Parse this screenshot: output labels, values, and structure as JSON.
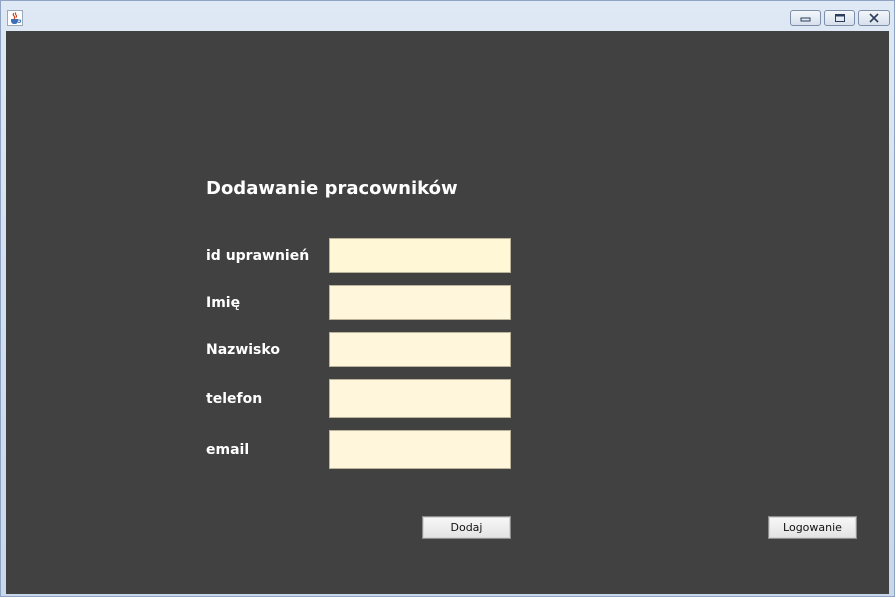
{
  "form": {
    "title": "Dodawanie pracowników",
    "fields": [
      {
        "label": "id uprawnień",
        "value": ""
      },
      {
        "label": "Imię",
        "value": ""
      },
      {
        "label": "Nazwisko",
        "value": ""
      },
      {
        "label": "telefon",
        "value": ""
      },
      {
        "label": "email",
        "value": ""
      }
    ],
    "add_button": "Dodaj"
  },
  "login_button": "Logowanie",
  "icons": {
    "app": "java-cup-icon",
    "minimize": "minimize-icon",
    "maximize": "maximize-icon",
    "close": "close-icon"
  }
}
